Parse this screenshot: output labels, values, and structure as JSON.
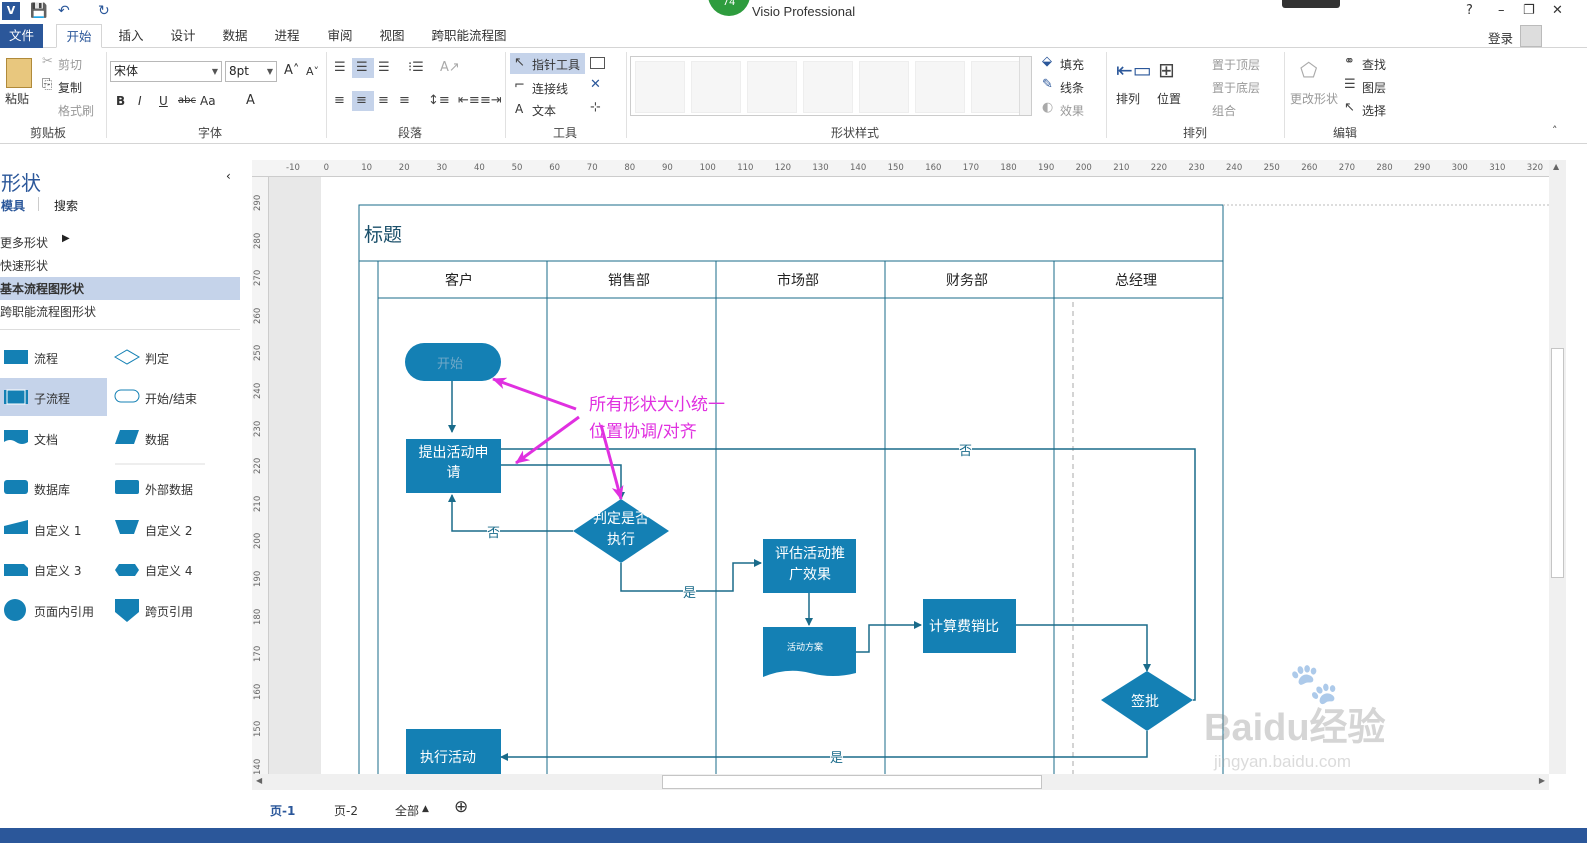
{
  "window": {
    "title": "Visio Professional",
    "badge": "74",
    "help": "?",
    "min": "–",
    "restore": "❐",
    "close": "✕"
  },
  "tabs": [
    "文件",
    "开始",
    "插入",
    "设计",
    "数据",
    "进程",
    "审阅",
    "视图",
    "跨职能流程图"
  ],
  "login": "登录",
  "ribbon": {
    "clipboard": {
      "paste": "粘贴",
      "cut": "剪切",
      "copy": "复制",
      "format_painter": "格式刷",
      "label": "剪贴板"
    },
    "font": {
      "name": "宋体",
      "size": "8pt",
      "label": "字体",
      "bold": "B",
      "italic": "I",
      "underline": "U",
      "strike": "abc",
      "case": "Aa",
      "color": "A"
    },
    "paragraph": {
      "label": "段落"
    },
    "tools": {
      "pointer": "指针工具",
      "connector": "连接线",
      "text": "文本",
      "label": "工具"
    },
    "shape_styles": {
      "fill": "填充",
      "line": "线条",
      "effects": "效果",
      "label": "形状样式"
    },
    "arrange": {
      "arrange": "排列",
      "position": "位置",
      "bring_front": "置于顶层",
      "send_back": "置于底层",
      "group": "组合",
      "label": "排列"
    },
    "editing": {
      "change_shape": "更改形状",
      "find": "查找",
      "layers": "图层",
      "select": "选择",
      "label": "编辑"
    }
  },
  "panel": {
    "title": "形状",
    "tab_stencils": "模具",
    "tab_search": "搜索",
    "more_shapes": "更多形状",
    "quick_shapes": "快速形状",
    "basic_flowchart": "基本流程图形状",
    "cff_shapes": "跨职能流程图形状",
    "shapes": [
      "流程",
      "判定",
      "子流程",
      "开始/结束",
      "文档",
      "数据",
      "数据库",
      "外部数据",
      "自定义 1",
      "自定义 2",
      "自定义 3",
      "自定义 4",
      "页面内引用",
      "跨页引用"
    ]
  },
  "ruler": {
    "h": [
      "-10",
      "0",
      "10",
      "20",
      "30",
      "40",
      "50",
      "60",
      "70",
      "80",
      "90",
      "100",
      "110",
      "120",
      "130",
      "140",
      "150",
      "160",
      "170",
      "180",
      "190",
      "200",
      "210",
      "220",
      "230",
      "240",
      "250",
      "260",
      "270",
      "280",
      "290",
      "300",
      "310",
      "320"
    ],
    "v": [
      "290",
      "280",
      "270",
      "260",
      "250",
      "240",
      "230",
      "220",
      "210",
      "200",
      "190",
      "180",
      "170",
      "160",
      "150",
      "140"
    ]
  },
  "diagram": {
    "title": "标题",
    "lanes": [
      "客户",
      "销售部",
      "市场部",
      "财务部",
      "总经理"
    ],
    "start": "开始",
    "submit": "提出活动申请",
    "decide": "判定是否执行",
    "evaluate": "评估活动推广效果",
    "plan": "活动方案",
    "cost": "计算费销比",
    "approve": "签批",
    "execute": "执行活动",
    "yes": "是",
    "no": "否",
    "note_line1": "所有形状大小统一",
    "note_line2": "位置协调/对齐"
  },
  "pages": {
    "page1": "页-1",
    "page2": "页-2",
    "all": "全部",
    "add": "⊕"
  },
  "watermark": {
    "logo": "Baidu经验",
    "url": "jingyan.baidu.com"
  },
  "colors": {
    "accent": "#2b579a",
    "shape": "#1480b4",
    "lane_line": "#1a6b8a",
    "annotation": "#e030e0"
  }
}
